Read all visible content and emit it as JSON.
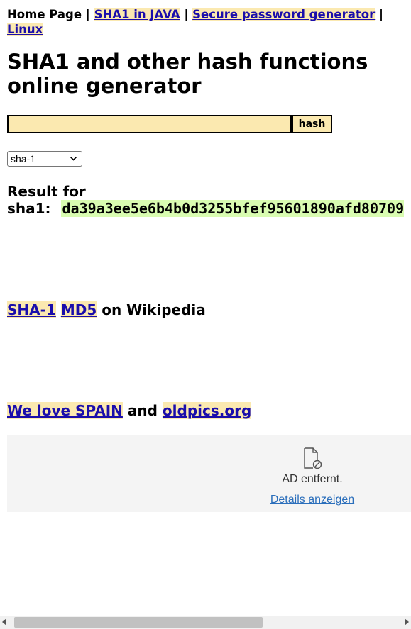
{
  "nav": {
    "home": "Home Page",
    "sep": " | ",
    "link_java": "SHA1 in JAVA",
    "link_secure": "Secure password generator",
    "link_linux": "Linux"
  },
  "title": "SHA1 and other hash functions online generator",
  "form": {
    "input_value": "",
    "button_label": "hash",
    "select_value": "sha-1"
  },
  "result": {
    "label_line1": "Result for",
    "label_line2": "sha1:",
    "hash": "da39a3ee5e6b4b0d3255bfef95601890afd80709"
  },
  "wiki": {
    "link_sha1": "SHA-1",
    "link_md5": "MD5",
    "suffix": "on Wikipedia"
  },
  "promo": {
    "link_spain": "We love SPAIN",
    "and": "and",
    "link_oldpics": "oldpics.org"
  },
  "ad": {
    "icon": "blocked-document-icon",
    "text": "AD entfernt.",
    "details_link": "Details anzeigen"
  },
  "colors": {
    "link_bg": "#fbe9b0",
    "hash_bg": "#d9fcb1",
    "link": "#1a0dab"
  }
}
